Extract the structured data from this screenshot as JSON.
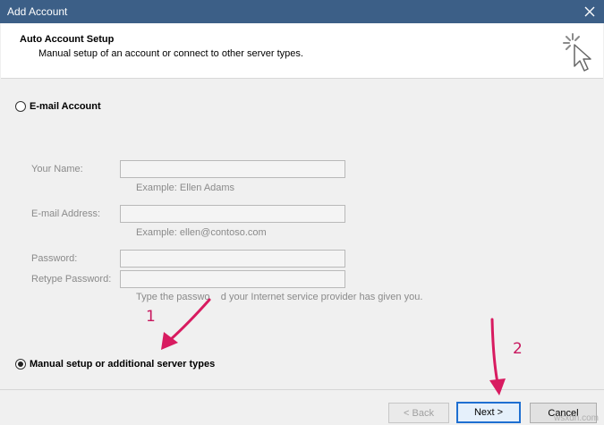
{
  "window": {
    "title": "Add Account",
    "close_icon": "close-icon"
  },
  "header": {
    "title": "Auto Account Setup",
    "subtitle": "Manual setup of an account or connect to other server types.",
    "icon": "wizard-cursor-icon"
  },
  "options": {
    "email_account": {
      "label": "E-mail Account",
      "checked": false
    },
    "manual_setup": {
      "label": "Manual setup or additional server types",
      "checked": true
    }
  },
  "fields": {
    "your_name": {
      "label": "Your Name:",
      "hint": "Example: Ellen Adams",
      "value": ""
    },
    "email_address": {
      "label": "E-mail Address:",
      "hint": "Example: ellen@contoso.com",
      "value": ""
    },
    "password": {
      "label": "Password:",
      "value": ""
    },
    "retype_password": {
      "label": "Retype Password:",
      "value": ""
    },
    "password_hint": "Type the passwo    d your Internet service provider has given you."
  },
  "annotations": {
    "step1": "1",
    "step2": "2",
    "arrow_color": "#d81b60"
  },
  "buttons": {
    "back": "< Back",
    "next": "Next >",
    "cancel": "Cancel"
  },
  "watermark": "wsxdn.com"
}
